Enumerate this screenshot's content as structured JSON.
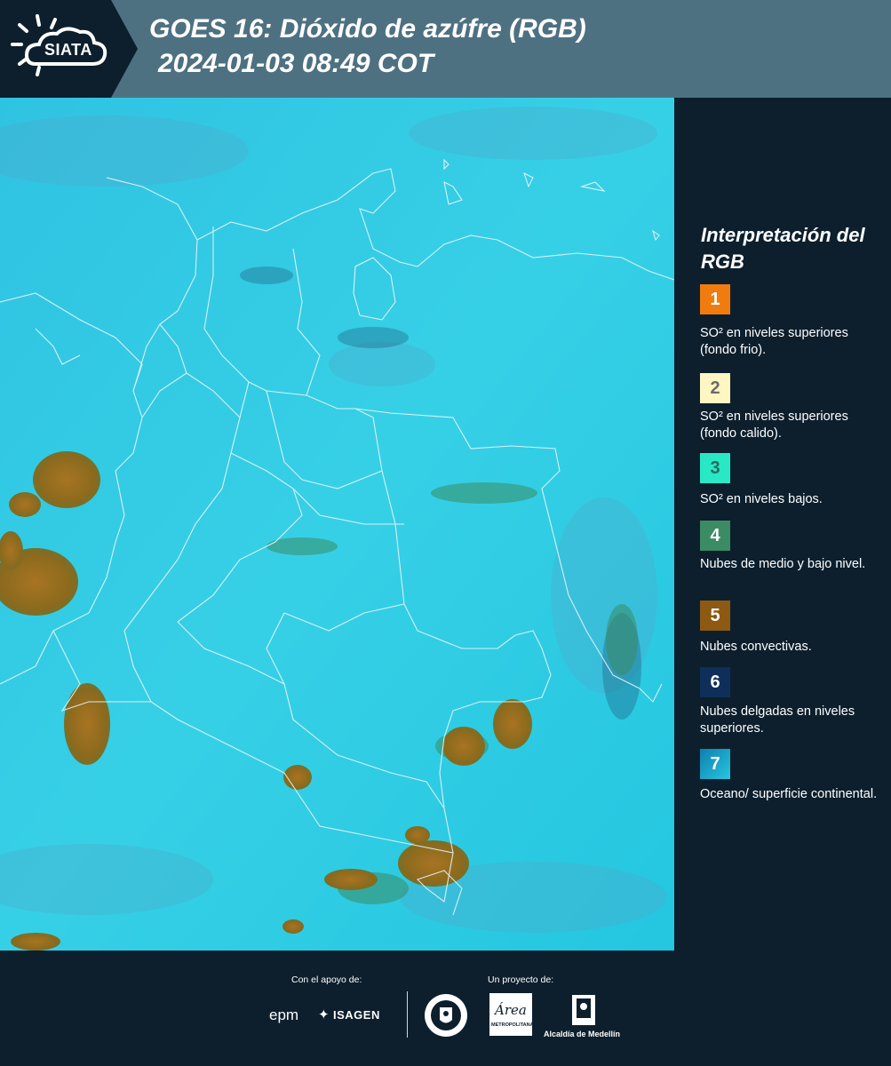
{
  "header": {
    "logo_text": "SIATA",
    "title": "GOES 16: Dióxido de azúfre (RGB)",
    "datetime": "2024-01-03 08:49 COT"
  },
  "legend": {
    "title": "Interpretación del RGB",
    "items": [
      {
        "number": "1",
        "color": "#f07c10",
        "text_color": "#ffffff",
        "label": "SO² en niveles superiores (fondo frio)."
      },
      {
        "number": "2",
        "color": "#fff6c2",
        "text_color": "#6b6b6b",
        "label": "SO² en niveles superiores (fondo calido)."
      },
      {
        "number": "3",
        "color": "#29e8c6",
        "text_color": "#2a6b63",
        "label": "SO² en niveles bajos."
      },
      {
        "number": "4",
        "color": "#3b8c64",
        "text_color": "#ffffff",
        "label": "Nubes de medio y bajo nivel."
      },
      {
        "number": "5",
        "color": "#8c5a12",
        "text_color": "#ffffff",
        "label": "Nubes convectivas."
      },
      {
        "number": "6",
        "color": "#0f2e5a",
        "text_color": "#ffffff",
        "label": "Nubes delgadas en niveles superiores."
      },
      {
        "number": "7",
        "color": "#1ba9c8",
        "text_color": "#ffffff",
        "label": "Oceano/ superficie continental."
      }
    ]
  },
  "footer": {
    "support_label": "Con el apoyo de:",
    "project_label": "Un proyecto de:",
    "sponsor_1": "epm",
    "sponsor_2": "ISAGEN",
    "partner_1": "Área",
    "partner_1_sub": "METROPOLITANA",
    "partner_2": "Alcaldía de Medellín"
  },
  "colors": {
    "header_bg": "#4e7182",
    "panel_bg": "#0d1f2d",
    "ocean": "#26c2e0",
    "convective": "#8c6b1e"
  }
}
